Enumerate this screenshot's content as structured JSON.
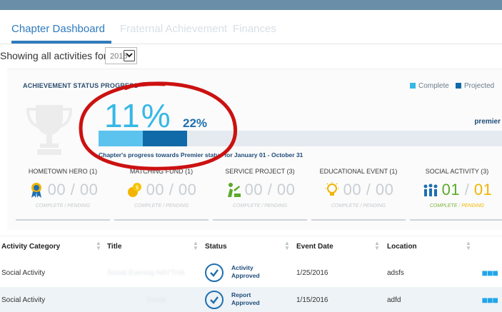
{
  "tabs": [
    {
      "label": "Chapter Dashboard",
      "active": true
    },
    {
      "label": "Fraternal Achievement",
      "active": false
    },
    {
      "label": "Finances",
      "active": false
    }
  ],
  "filter": {
    "label": "Showing all activities for",
    "year": "2016"
  },
  "achievement": {
    "title": "ACHIEVEMENT STATUS PROGRESS",
    "legend": [
      {
        "label": "Complete",
        "color": "#36b8e6"
      },
      {
        "label": "Projected",
        "color": "#116aa8"
      }
    ],
    "complete_pct_label": "11%",
    "projected_pct_label": "22%",
    "complete_fraction": 0.11,
    "projected_fraction": 0.22,
    "tier_label": "premier",
    "caption": "Chapter's progress towards Premier status for January 01 - October 31"
  },
  "categories": [
    {
      "label": "HOMETOWN HERO (1)",
      "icon": "ribbon-icon",
      "complete": "00",
      "pending": "00",
      "sub_a": "COMPLETE",
      "sub_b": "PENDING"
    },
    {
      "label": "MATCHING FUND (1)",
      "icon": "coins-icon",
      "complete": "00",
      "pending": "00",
      "sub_a": "COMPLETE",
      "sub_b": "PENDING"
    },
    {
      "label": "SERVICE PROJECT (3)",
      "icon": "service-icon",
      "complete": "00",
      "pending": "00",
      "sub_a": "COMPLETE",
      "sub_b": "PENDING"
    },
    {
      "label": "EDUCATIONAL EVENT (1)",
      "icon": "lightbulb-icon",
      "complete": "00",
      "pending": "00",
      "sub_a": "COMPLETE",
      "sub_b": "PENDING"
    },
    {
      "label": "SOCIAL ACTIVITY (3)",
      "icon": "people-icon",
      "complete": "01",
      "pending": "01",
      "sub_a": "COMPLETE",
      "sub_b": "PENDING"
    }
  ],
  "table": {
    "headers": [
      "Activity Category",
      "Title",
      "Status",
      "Event Date",
      "Location"
    ],
    "rows": [
      {
        "category": "Social Activity",
        "title": "Social Evening NAYTHA",
        "status_line1": "Activity",
        "status_line2": "Approved",
        "date": "1/25/2016",
        "location": "adsfs"
      },
      {
        "category": "Social Activity",
        "title": "Social",
        "status_line1": "Report",
        "status_line2": "Approved",
        "date": "1/15/2016",
        "location": "adfd"
      }
    ]
  },
  "colors": {
    "accent": "#2f7bbd",
    "annotation": "#cc1111"
  }
}
